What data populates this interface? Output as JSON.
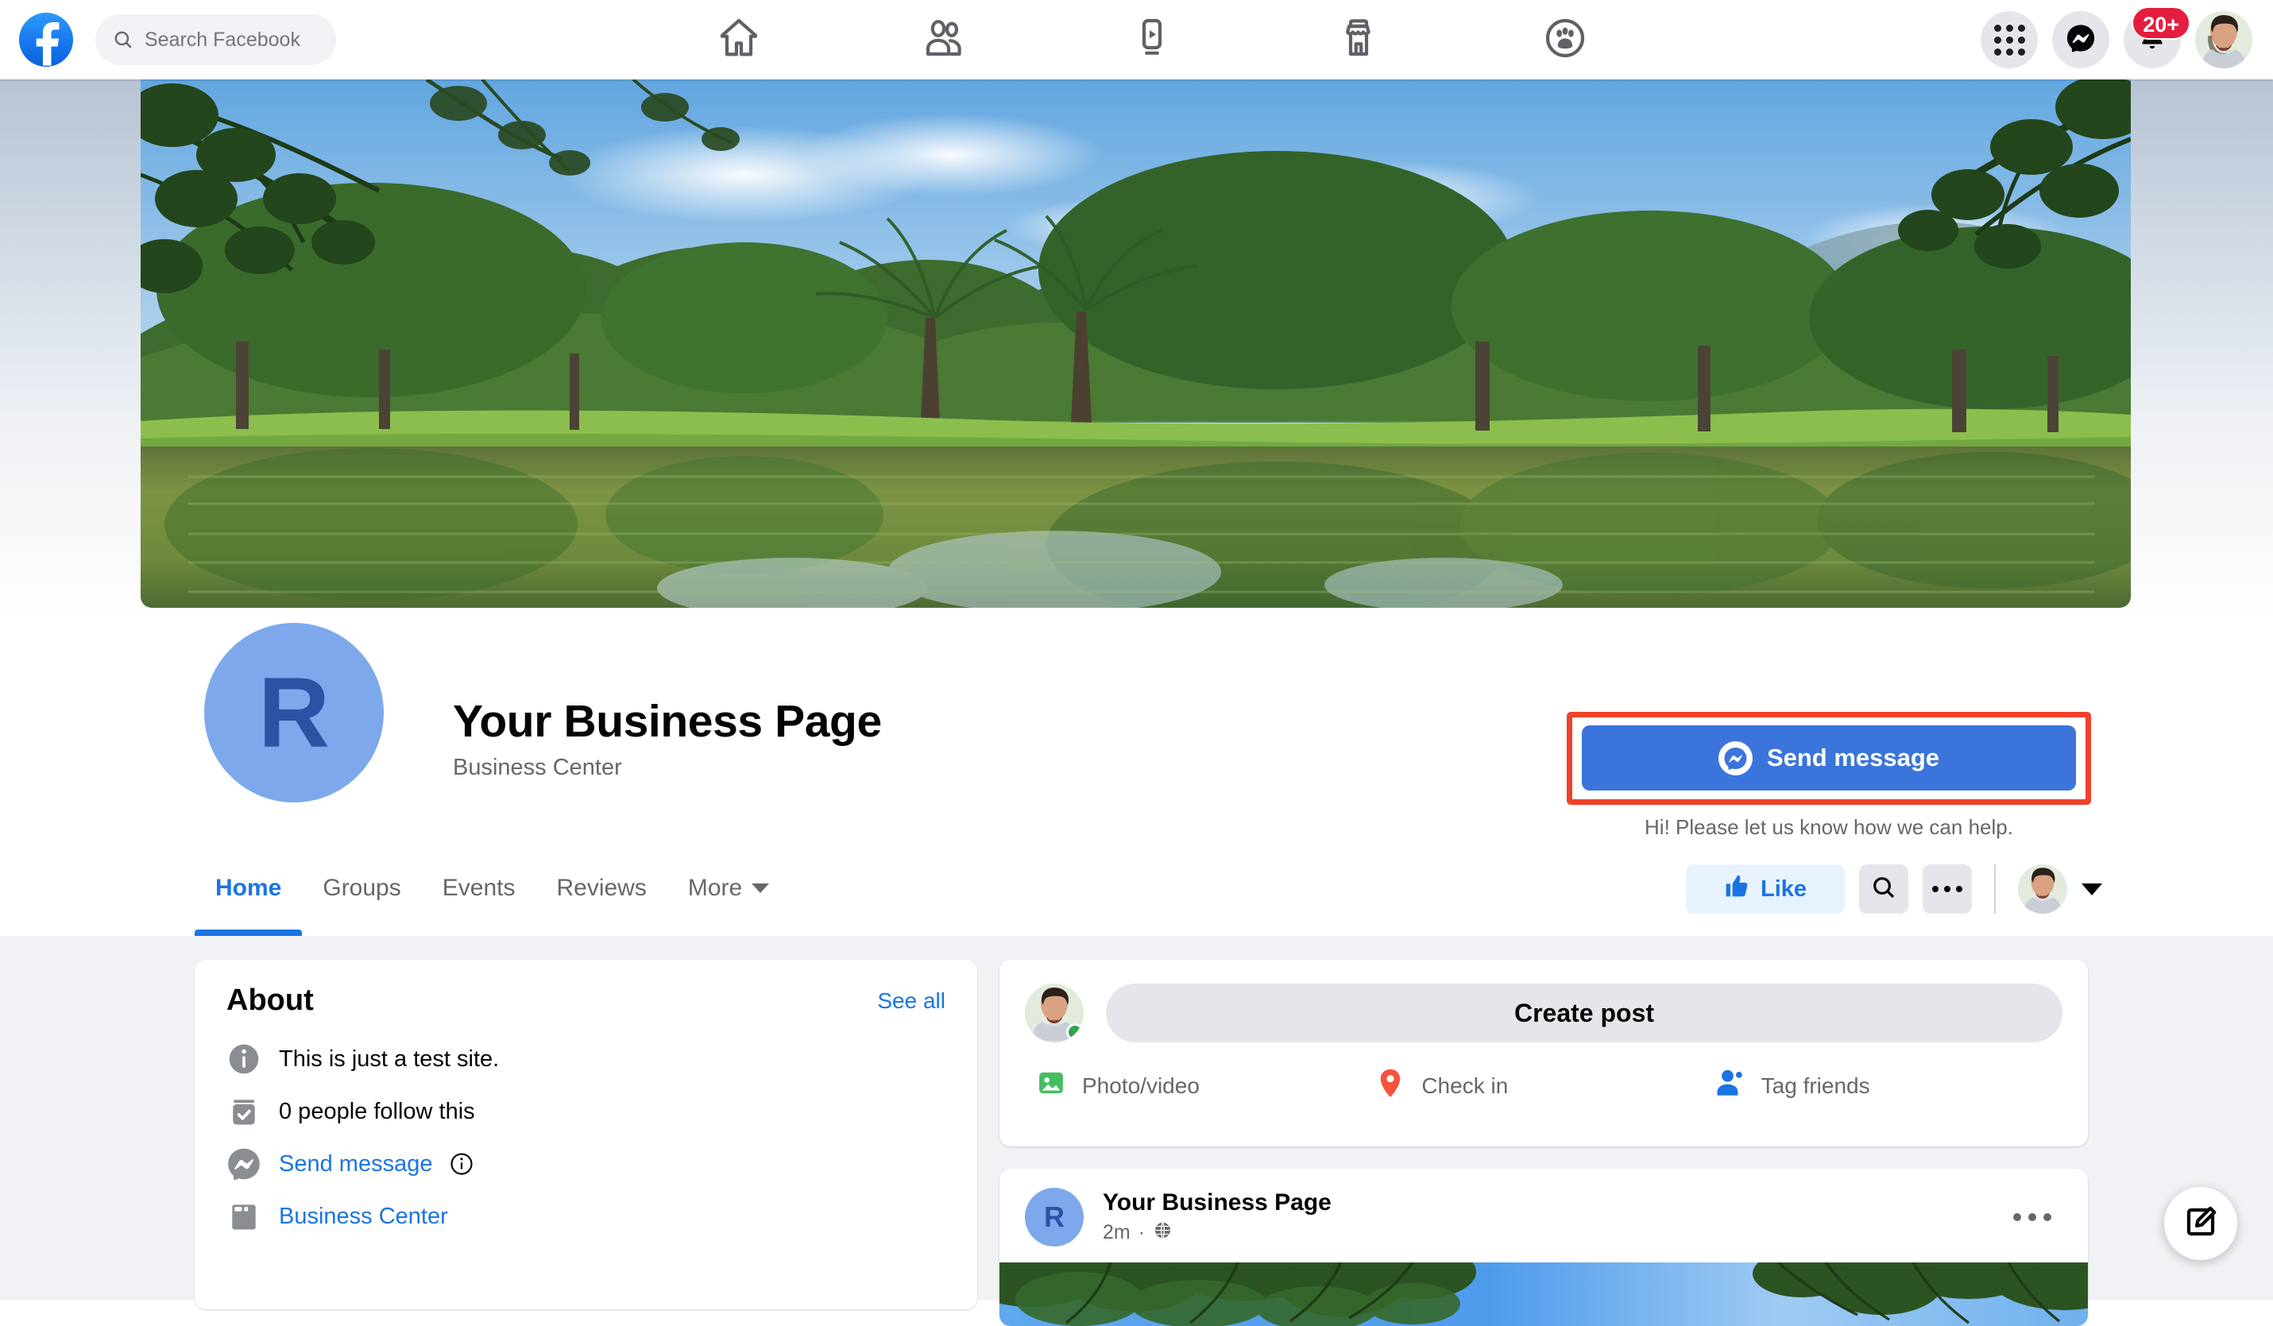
{
  "topbar": {
    "logo_icon": "facebook-logo",
    "search": {
      "placeholder": "Search Facebook",
      "value": "",
      "icon": "search-icon"
    },
    "nav_items": [
      {
        "name": "home",
        "icon": "home-icon"
      },
      {
        "name": "friends",
        "icon": "friends-icon"
      },
      {
        "name": "watch",
        "icon": "video-play-icon"
      },
      {
        "name": "marketplace",
        "icon": "storefront-icon"
      },
      {
        "name": "groups",
        "icon": "groups-icon"
      }
    ],
    "right": {
      "menu_icon": "grid-menu-icon",
      "messenger_icon": "messenger-icon",
      "notifications_icon": "bell-icon",
      "notifications_badge": "20+",
      "avatar": "user-avatar"
    }
  },
  "cover": {
    "alt": "park lake with trees reflected in green water",
    "icon": "cover-photo"
  },
  "profile": {
    "avatar_letter": "R",
    "title": "Your Business Page",
    "subtitle": "Business Center",
    "send_message_label": "Send message",
    "send_message_icon": "messenger-icon",
    "send_message_help": "Hi! Please let us know how we can help.",
    "highlight_color": "#F0422A",
    "button_color": "#3B75DB"
  },
  "tabs": {
    "items": [
      {
        "label": "Home",
        "active": true
      },
      {
        "label": "Groups",
        "active": false
      },
      {
        "label": "Events",
        "active": false
      },
      {
        "label": "Reviews",
        "active": false
      },
      {
        "label": "More",
        "active": false,
        "caret": true
      }
    ],
    "actions": {
      "like_label": "Like",
      "like_icon": "thumbs-up-icon",
      "search_icon": "search-icon",
      "more_icon": "ellipsis-icon",
      "avatar": "user-avatar",
      "caret_icon": "chevron-down-icon"
    },
    "active_color": "#1B74E4"
  },
  "about": {
    "title": "About",
    "see_all": "See all",
    "items": [
      {
        "icon": "info-icon",
        "text": "This is just a test site.",
        "link": false
      },
      {
        "icon": "followers-check-icon",
        "text": "0 people follow this",
        "link": false
      },
      {
        "icon": "messenger-icon",
        "text": "Send message",
        "link": true,
        "trailing_icon": "info-outline-icon"
      },
      {
        "icon": "business-center-icon",
        "text": "Business Center",
        "link": true
      }
    ]
  },
  "create_post": {
    "avatar": "user-avatar",
    "placeholder": "Create post",
    "actions": [
      {
        "label": "Photo/video",
        "icon": "photo-video-icon",
        "color": "#45BD62"
      },
      {
        "label": "Check in",
        "icon": "location-pin-icon",
        "color": "#F5533D"
      },
      {
        "label": "Tag friends",
        "icon": "tag-friends-icon",
        "color": "#1B74E4"
      }
    ]
  },
  "post": {
    "avatar_letter": "R",
    "author": "Your Business Page",
    "time": "2m",
    "separator": "·",
    "audience_icon": "globe-icon",
    "menu_icon": "ellipsis-icon",
    "image_alt": "blue sky framed by tree branches"
  },
  "fab": {
    "icon": "compose-icon"
  }
}
